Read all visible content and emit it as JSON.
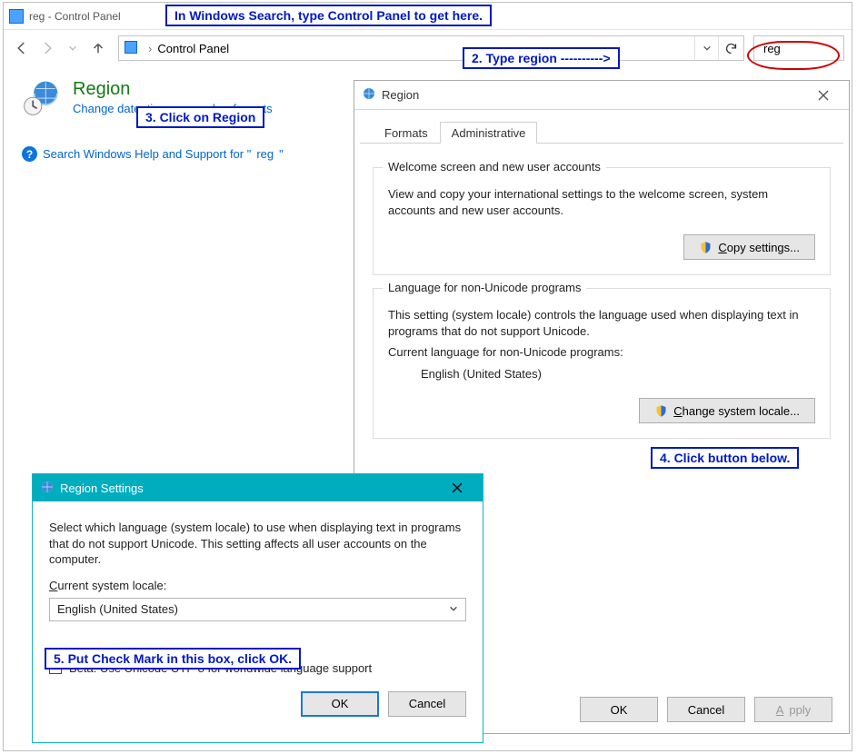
{
  "annotations": {
    "hint1": "In Windows Search, type Control Panel to get here.",
    "hint2": "2. Type region ---------->",
    "hint3": "3. Click on Region",
    "hint4": "4. Click button below.",
    "hint5": "5. Put Check Mark in this box, click OK."
  },
  "control_panel": {
    "window_title": "reg - Control Panel",
    "breadcrumb": "Control Panel",
    "search_value": "reg",
    "result": {
      "title": "Region",
      "subtitle": "Change date, time, or number formats"
    },
    "help_link_prefix": "Search Windows Help and Support for \"",
    "help_link_term": "reg",
    "help_link_suffix": "\""
  },
  "region_dialog": {
    "title": "Region",
    "tabs": {
      "formats": "Formats",
      "admin": "Administrative"
    },
    "welcome_group": {
      "legend": "Welcome screen and new user accounts",
      "text": "View and copy your international settings to the welcome screen, system accounts and new user accounts.",
      "button_u": "C",
      "button_rest": "opy settings..."
    },
    "locale_group": {
      "legend": "Language for non-Unicode programs",
      "text": "This setting (system locale) controls the language used when displaying text in programs that do not support Unicode.",
      "current_label": "Current language for non-Unicode programs:",
      "current_value": "English (United States)",
      "button_u": "C",
      "button_rest": "hange system locale..."
    },
    "buttons": {
      "ok": "OK",
      "cancel": "Cancel",
      "apply_u": "A",
      "apply_rest": "pply"
    }
  },
  "region_settings": {
    "title": "Region Settings",
    "intro": "Select which language (system locale) to use when displaying text in programs that do not support Unicode. This setting affects all user accounts on the computer.",
    "label_u": "C",
    "label_rest": "urrent system locale:",
    "selected": "English (United States)",
    "checkbox": "Beta: Use Unicode UTF-8 for worldwide language support",
    "ok": "OK",
    "cancel": "Cancel"
  }
}
